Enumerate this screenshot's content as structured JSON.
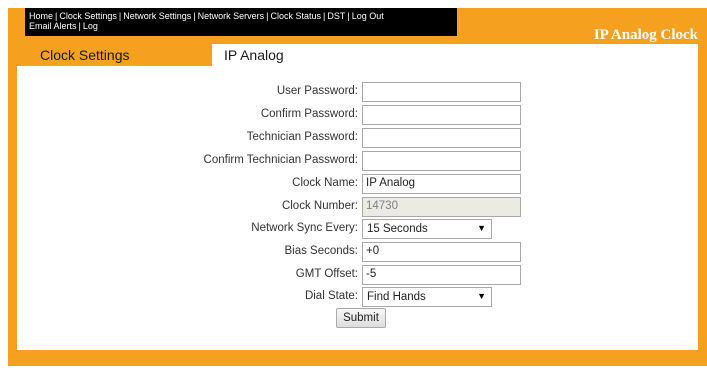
{
  "nav": {
    "line1": [
      "Home",
      "Clock Settings",
      "Network Settings",
      "Network Servers",
      "Clock Status",
      "DST",
      "Log Out"
    ],
    "line2": [
      "Email Alerts",
      "Log"
    ],
    "separator": "|"
  },
  "app_title": "IP Analog Clock",
  "section_title": "Clock Settings",
  "panel_tab": "IP Analog",
  "form": {
    "user_password": {
      "label": "User Password:",
      "value": ""
    },
    "confirm_password": {
      "label": "Confirm Password:",
      "value": ""
    },
    "technician_password": {
      "label": "Technician Password:",
      "value": ""
    },
    "confirm_technician_password": {
      "label": "Confirm Technician Password:",
      "value": ""
    },
    "clock_name": {
      "label": "Clock Name:",
      "value": "IP Analog"
    },
    "clock_number": {
      "label": "Clock Number:",
      "value": "14730"
    },
    "network_sync": {
      "label": "Network Sync Every:",
      "value": "15 Seconds"
    },
    "bias_seconds": {
      "label": "Bias Seconds:",
      "value": "+0"
    },
    "gmt_offset": {
      "label": "GMT Offset:",
      "value": "-5"
    },
    "dial_state": {
      "label": "Dial State:",
      "value": "Find Hands"
    },
    "submit_label": "Submit"
  },
  "colors": {
    "frame": "#f5a11f",
    "navbar": "#000000"
  }
}
